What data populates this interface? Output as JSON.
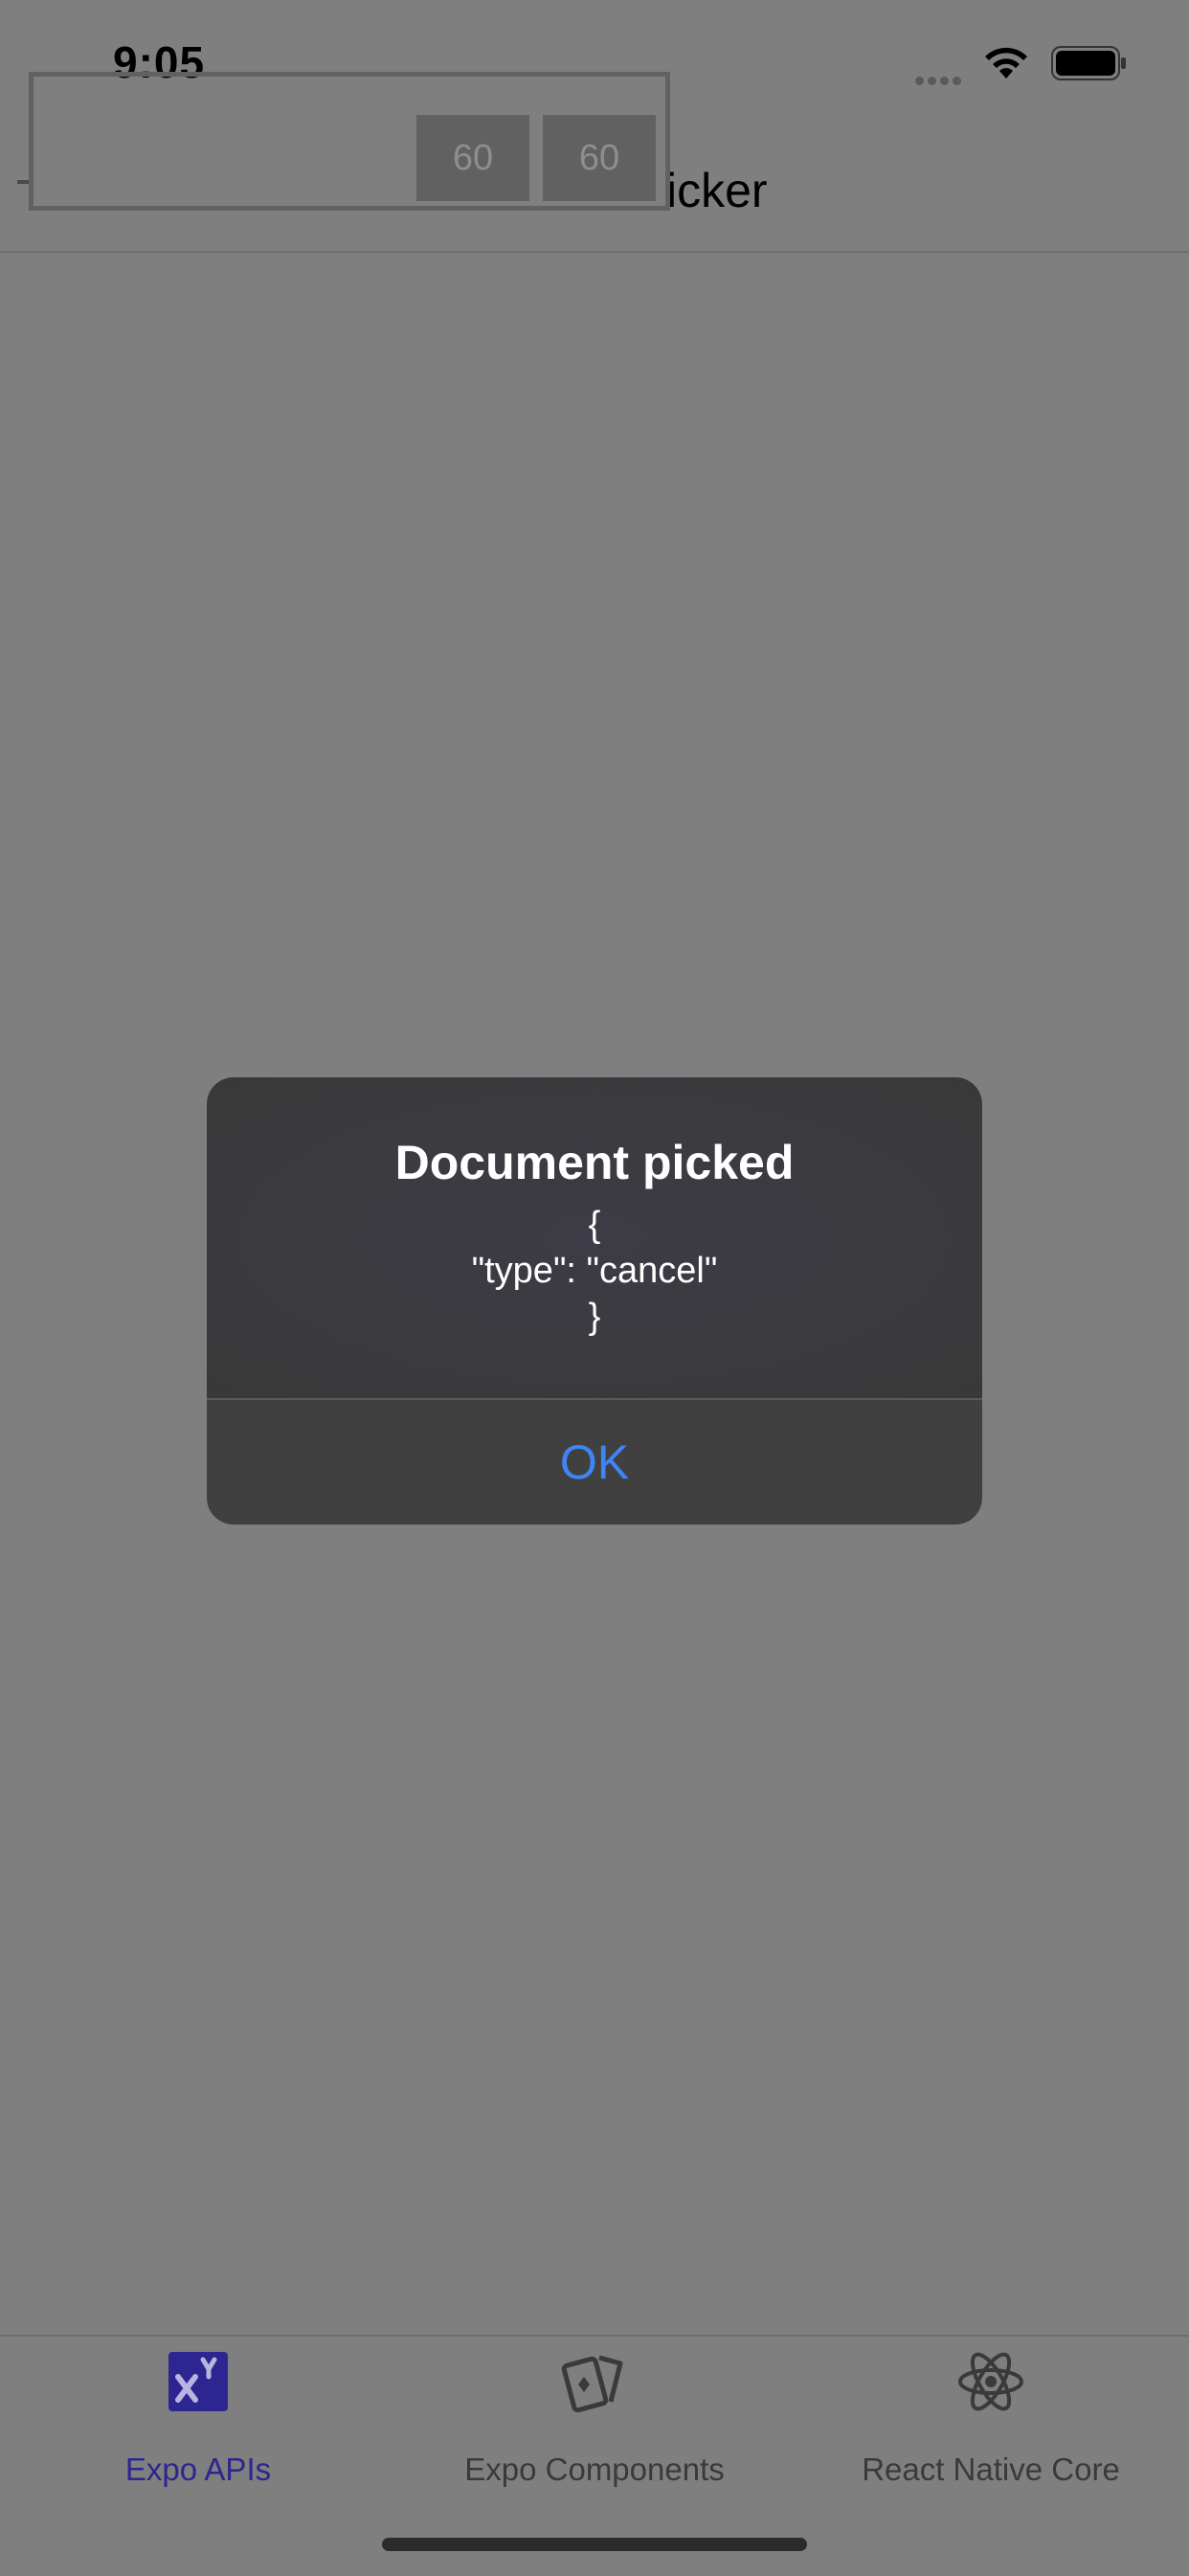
{
  "status_bar": {
    "time": "9:05"
  },
  "header": {
    "title_visible_fragment": "icker"
  },
  "perf_monitor": {
    "js_fps": "60",
    "ui_fps": "60"
  },
  "alert": {
    "title": "Document picked",
    "message_lines": [
      "{",
      "\"type\": \"cancel\"",
      "}"
    ],
    "ok_label": "OK"
  },
  "tab_bar": {
    "tabs": [
      {
        "label": "Expo APIs",
        "icon": "expo-apis-icon",
        "active": true
      },
      {
        "label": "Expo Components",
        "icon": "expo-components-icon",
        "active": false
      },
      {
        "label": "React Native Core",
        "icon": "react-icon",
        "active": false
      }
    ]
  },
  "colors": {
    "overlay_background": "#7f7f7f",
    "active_tab": "#2d2590",
    "alert_button_text": "#3f85f5"
  }
}
